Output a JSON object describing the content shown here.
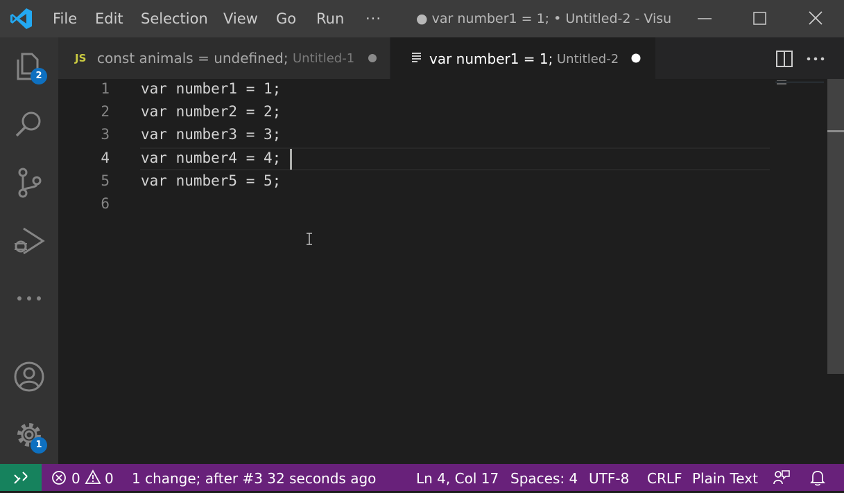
{
  "menu": {
    "file": "File",
    "edit": "Edit",
    "selection": "Selection",
    "view": "View",
    "go": "Go",
    "run": "Run",
    "more": "···"
  },
  "window_title": "● var number1 = 1; • Untitled-2 - Visu...",
  "activity_bar": {
    "explorer_badge": "2",
    "manage_badge": "1"
  },
  "tabs": [
    {
      "icon": "JS",
      "label": "const animals = undefined;",
      "description": "Untitled-1",
      "active": false
    },
    {
      "label": "var number1 = 1;",
      "description": "Untitled-2",
      "active": true
    }
  ],
  "editor": {
    "lines": [
      {
        "number": "1",
        "text": "var number1 = 1;"
      },
      {
        "number": "2",
        "text": "var number2 = 2;"
      },
      {
        "number": "3",
        "text": "var number3 = 3;"
      },
      {
        "number": "4",
        "text": "var number4 = 4;"
      },
      {
        "number": "5",
        "text": "var number5 = 5;"
      },
      {
        "number": "6",
        "text": ""
      }
    ],
    "current_line": 4
  },
  "statusbar": {
    "errors": "0",
    "warnings": "0",
    "change_info": "1 change; after #3  32 seconds ago",
    "position": "Ln 4, Col 17",
    "spaces": "Spaces: 4",
    "encoding": "UTF-8",
    "eol": "CRLF",
    "language": "Plain Text"
  },
  "colors": {
    "status_bar": "#68217a",
    "remote_indicator": "#16825d",
    "badge": "#0e70c0",
    "js_icon": "#cbcb41"
  }
}
